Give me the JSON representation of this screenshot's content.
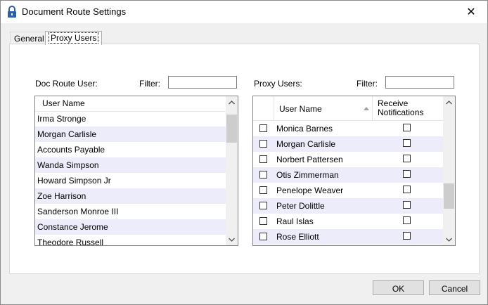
{
  "window": {
    "title": "Document Route Settings"
  },
  "tabs": [
    {
      "label": "General"
    },
    {
      "label": "Proxy Users"
    }
  ],
  "left_panel": {
    "label": "Doc Route User:",
    "filter_label": "Filter:",
    "filter_value": "",
    "column_header": "User Name",
    "rows": [
      "Irma Stronge",
      "Morgan Carlisle",
      "Accounts Payable",
      "Wanda Simpson",
      "Howard Simpson Jr",
      "Zoe Harrison",
      "Sanderson Monroe III",
      "Constance Jerome",
      "Theodore Russell"
    ]
  },
  "right_panel": {
    "label": "Proxy Users:",
    "filter_label": "Filter:",
    "filter_value": "",
    "column_user": "User Name",
    "column_notify": "Receive Notifications",
    "sort_icon": "sort-ascending-icon",
    "rows": [
      {
        "name": "Monica Barnes",
        "selected": false,
        "notify": false
      },
      {
        "name": "Morgan Carlisle",
        "selected": false,
        "notify": false
      },
      {
        "name": "Norbert Pattersen",
        "selected": false,
        "notify": false
      },
      {
        "name": "Otis Zimmerman",
        "selected": false,
        "notify": false
      },
      {
        "name": "Penelope Weaver",
        "selected": false,
        "notify": false
      },
      {
        "name": "Peter Dolittle",
        "selected": false,
        "notify": false
      },
      {
        "name": "Raul Islas",
        "selected": false,
        "notify": false
      },
      {
        "name": "Rose Elliott",
        "selected": false,
        "notify": false
      }
    ]
  },
  "buttons": {
    "ok": "OK",
    "cancel": "Cancel"
  },
  "colors": {
    "alt_row": "#ececfb",
    "window_bg": "#f0f0f0"
  }
}
